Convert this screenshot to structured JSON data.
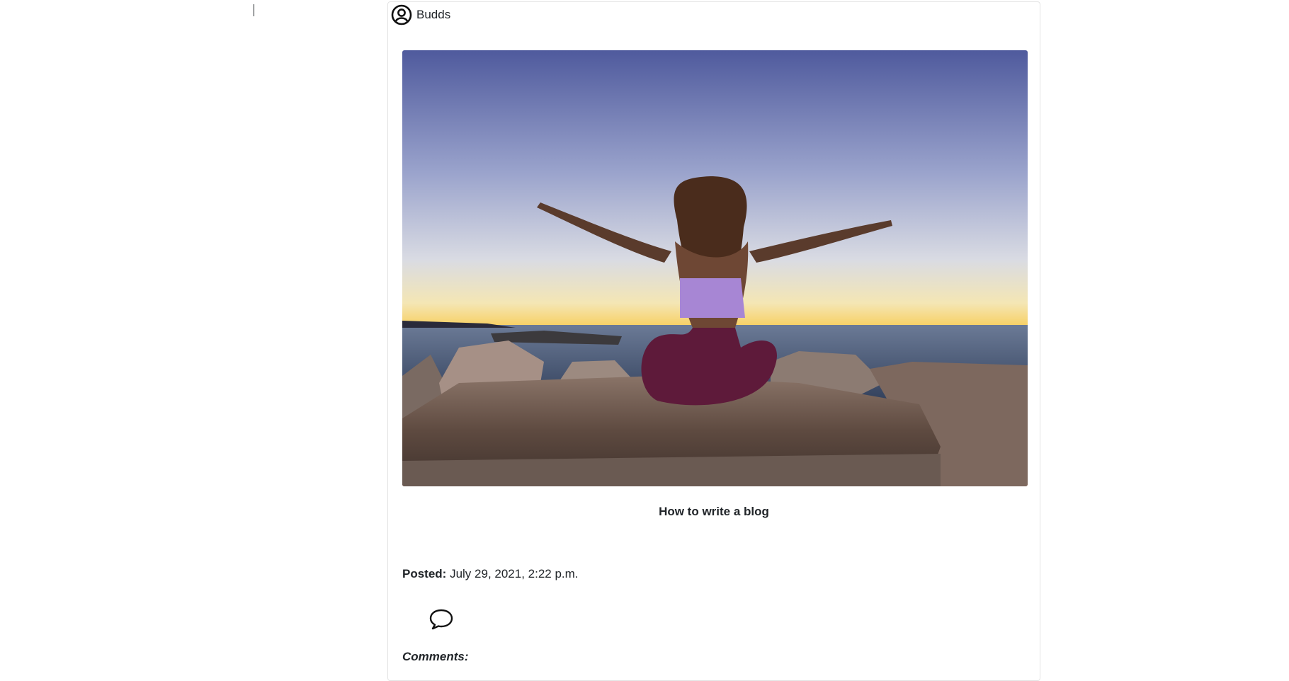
{
  "post": {
    "author": "Budds",
    "title": "How to write a blog",
    "posted_label": "Posted:",
    "posted_date": "July 29, 2021, 2:22 p.m.",
    "comments_label": "Comments:"
  },
  "icons": {
    "author": "user-circle-icon",
    "comment": "speech-bubble-icon"
  },
  "colors": {
    "text": "#212529",
    "card_border": "#e3e3e3",
    "sky_top": "#4e5a9c",
    "horizon": "#f5a623"
  }
}
